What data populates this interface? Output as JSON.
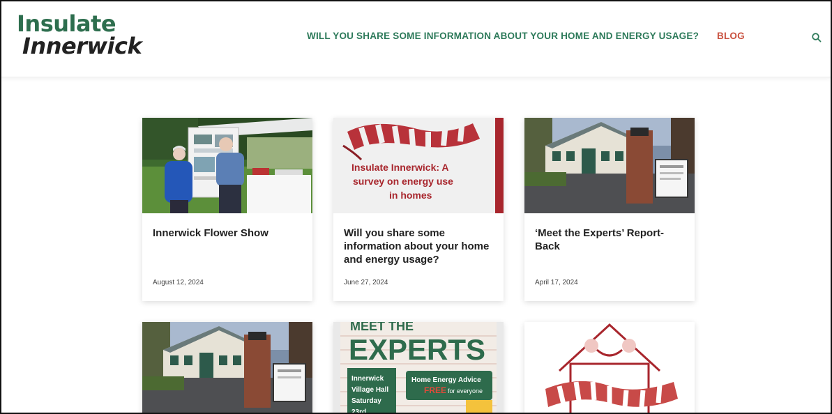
{
  "brand": {
    "line1": "Insulate",
    "line2": "Innerwick",
    "primary_color": "#2d6e4e",
    "accent_color": "#c9513f"
  },
  "nav": {
    "survey_link": "WILL YOU SHARE SOME INFORMATION ABOUT YOUR HOME AND ENERGY USAGE?",
    "blog_link": "BLOG",
    "search_icon": "search-icon"
  },
  "posts": [
    {
      "title": "Innerwick Flower Show",
      "date": "August 12, 2024",
      "image": "flower-show-photo"
    },
    {
      "title": "Will you share some information about your home and energy usage?",
      "date": "June 27, 2024",
      "image": "survey-poster",
      "image_text": "Insulate Innerwick: A survey on energy use in homes"
    },
    {
      "title": "‘Meet the Experts’ Report-Back",
      "date": "April 17, 2024",
      "image": "village-hall-photo"
    },
    {
      "title": "",
      "date": "",
      "image": "village-hall-photo"
    },
    {
      "title": "",
      "date": "",
      "image": "experts-poster",
      "image_text": "EXPERTS"
    },
    {
      "title": "",
      "date": "",
      "image": "house-scarf-illustration"
    }
  ]
}
